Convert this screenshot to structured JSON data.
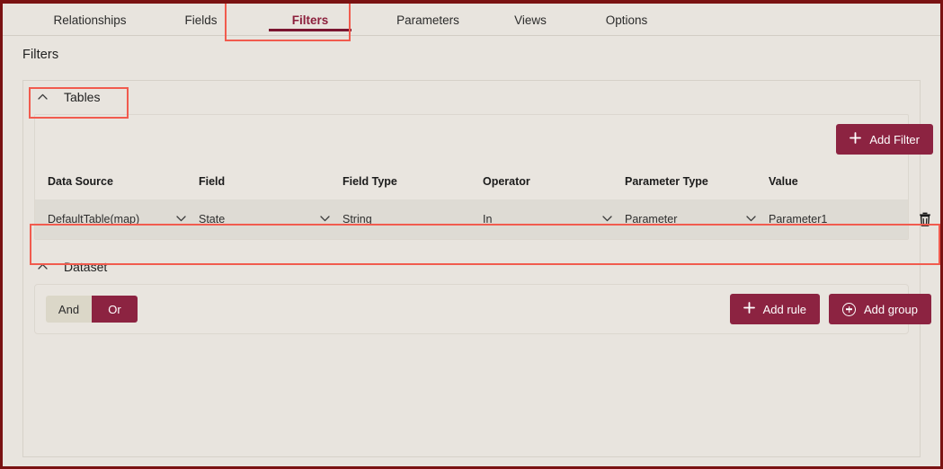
{
  "window": {
    "frame_color": "#7a1212",
    "background": "#e8e4de",
    "accent": "#8c2341",
    "annotation_color": "#f15b4e"
  },
  "tabs": [
    {
      "label": "Relationships",
      "active": false
    },
    {
      "label": "Fields",
      "active": false
    },
    {
      "label": "Filters",
      "active": true
    },
    {
      "label": "Parameters",
      "active": false
    },
    {
      "label": "Views",
      "active": false
    },
    {
      "label": "Options",
      "active": false
    }
  ],
  "page": {
    "title": "Filters"
  },
  "tables_section": {
    "title": "Tables",
    "collapse_icon": "chevron-up-icon",
    "expanded": true,
    "add_filter_label": "Add Filter",
    "add_filter_icon": "plus-icon",
    "columns": [
      "Data Source",
      "Field",
      "Field Type",
      "Operator",
      "Parameter Type",
      "Value"
    ],
    "rows": [
      {
        "data_source": "DefaultTable(map)",
        "field": "State",
        "field_type": "String",
        "operator": "In",
        "parameter_type": "Parameter",
        "value": "Parameter1",
        "delete_icon": "trash-icon"
      }
    ]
  },
  "dataset_section": {
    "title": "Dataset",
    "collapse_icon": "chevron-up-icon",
    "expanded": true,
    "logic_toggle": {
      "options": [
        "And",
        "Or"
      ],
      "selected": "Or"
    },
    "add_rule_label": "Add rule",
    "add_rule_icon": "plus-icon",
    "add_group_label": "Add group",
    "add_group_icon": "circle-plus-icon"
  },
  "icons": {
    "chevron_up": "⌃",
    "chevron_down": "⌄",
    "plus": "＋"
  }
}
